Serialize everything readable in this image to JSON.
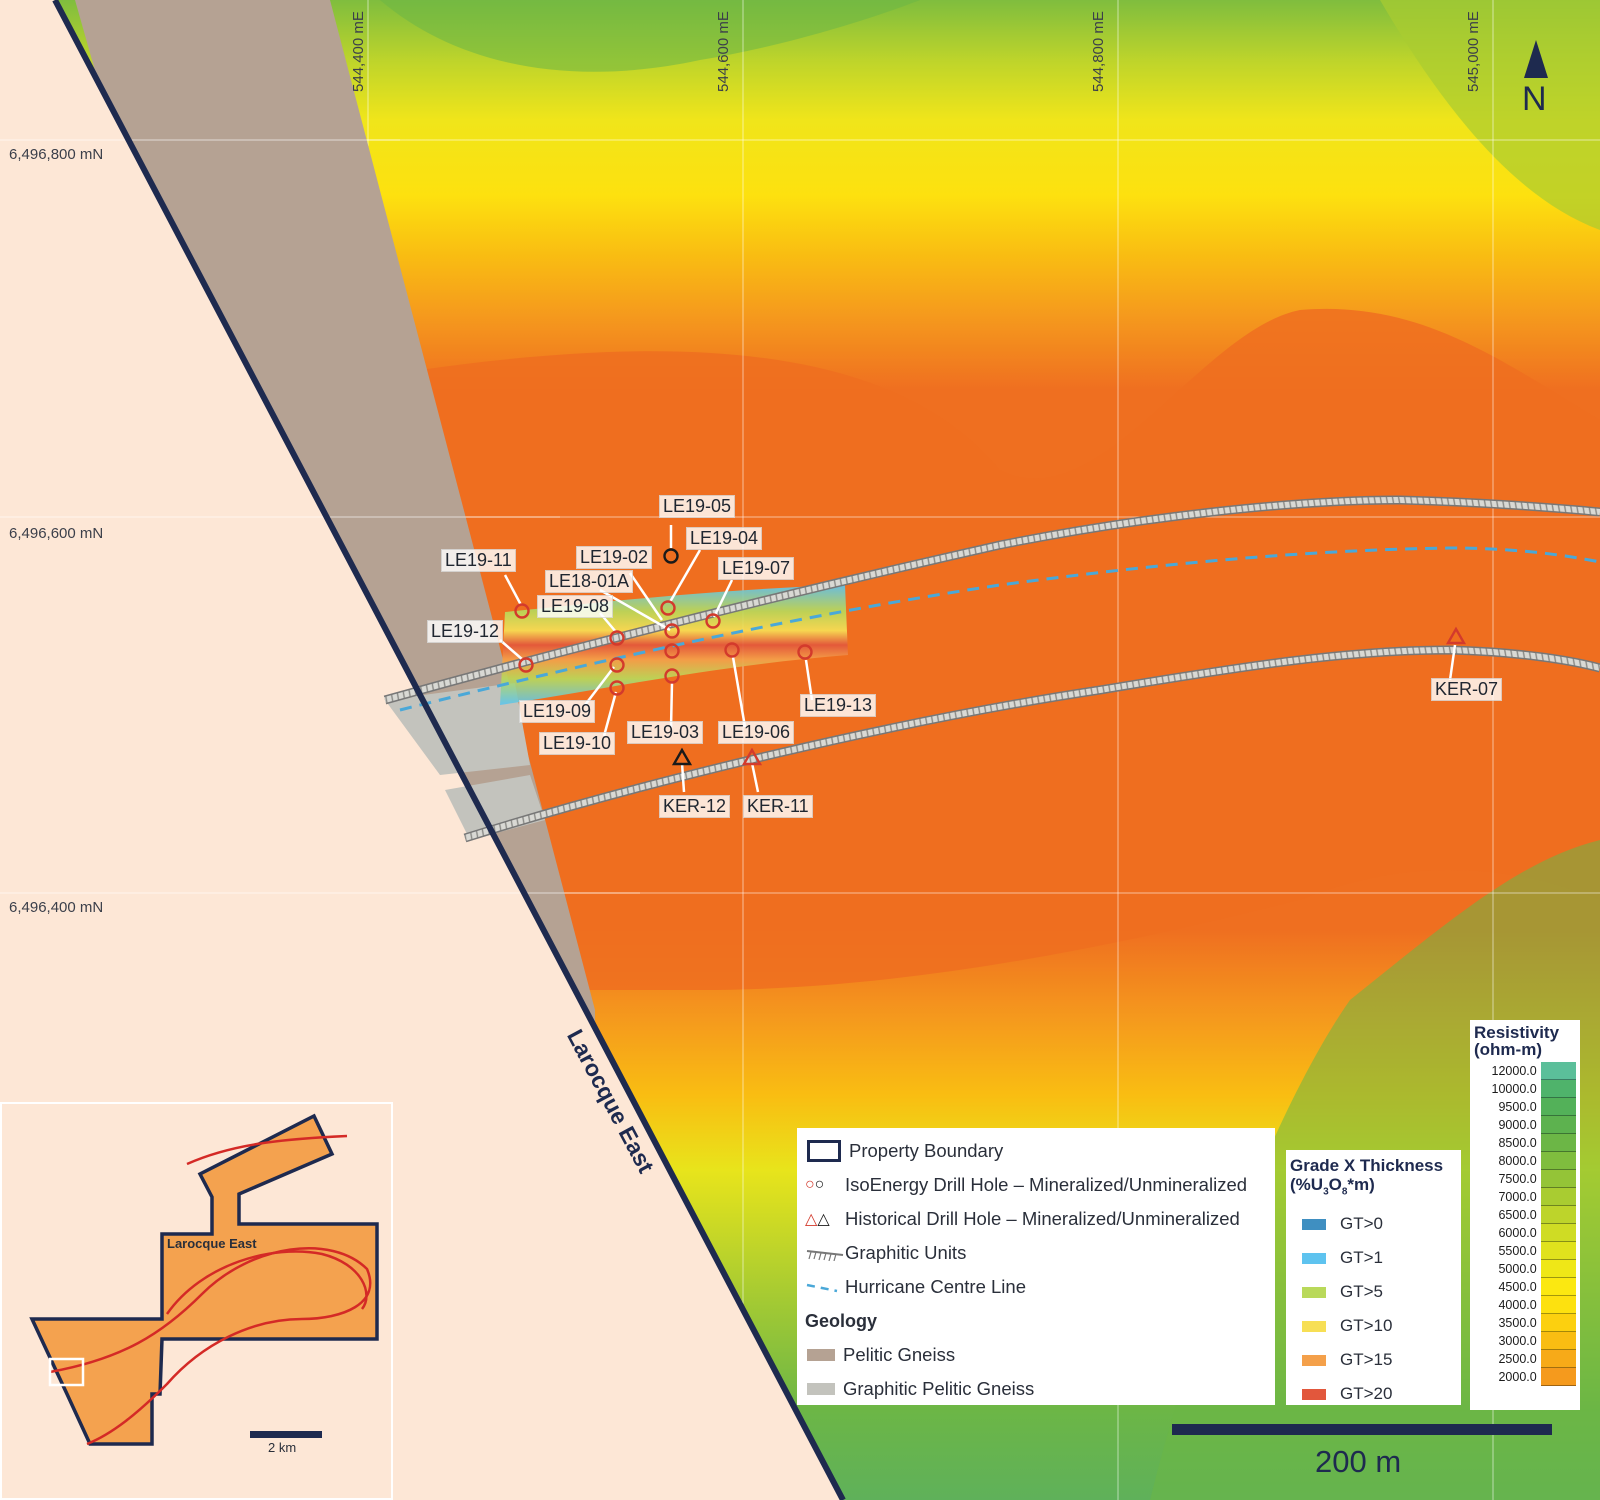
{
  "grid": {
    "eastings": [
      "544,400 mE",
      "544,600 mE",
      "544,800 mE",
      "545,000 mE"
    ],
    "northings": [
      "6,496,800 mN",
      "6,496,600 mN",
      "6,496,400 mN"
    ]
  },
  "north_arrow": "N",
  "property_label": "Larocque East",
  "drill_holes": [
    {
      "id": "LE19-05",
      "status": "unmineralized",
      "type": "isoenergy"
    },
    {
      "id": "LE19-04",
      "status": "mineralized",
      "type": "isoenergy"
    },
    {
      "id": "LE19-02",
      "status": "mineralized",
      "type": "isoenergy"
    },
    {
      "id": "LE19-07",
      "status": "mineralized",
      "type": "isoenergy"
    },
    {
      "id": "LE18-01A",
      "status": "mineralized",
      "type": "isoenergy"
    },
    {
      "id": "LE19-11",
      "status": "mineralized",
      "type": "isoenergy"
    },
    {
      "id": "LE19-08",
      "status": "mineralized",
      "type": "isoenergy"
    },
    {
      "id": "LE19-12",
      "status": "mineralized",
      "type": "isoenergy"
    },
    {
      "id": "LE19-13",
      "status": "mineralized",
      "type": "isoenergy"
    },
    {
      "id": "LE19-09",
      "status": "mineralized",
      "type": "isoenergy"
    },
    {
      "id": "LE19-03",
      "status": "mineralized",
      "type": "isoenergy"
    },
    {
      "id": "LE19-06",
      "status": "mineralized",
      "type": "isoenergy"
    },
    {
      "id": "LE19-10",
      "status": "mineralized",
      "type": "isoenergy"
    },
    {
      "id": "KER-12",
      "status": "unmineralized",
      "type": "historical"
    },
    {
      "id": "KER-11",
      "status": "mineralized",
      "type": "historical"
    },
    {
      "id": "KER-07",
      "status": "mineralized",
      "type": "historical"
    }
  ],
  "legend": {
    "property_boundary": "Property Boundary",
    "isoenergy_hole": "IsoEnergy Drill Hole – Mineralized/Unmineralized",
    "historical_hole": "Historical Drill Hole – Mineralized/Unmineralized",
    "graphitic_units": "Graphitic Units",
    "hurricane_line": "Hurricane Centre Line",
    "geology_title": "Geology",
    "pelitic_gneiss": "Pelitic Gneiss",
    "graphitic_pelitic_gneiss": "Graphitic Pelitic Gneiss",
    "colors": {
      "pelitic": "#b5a293",
      "graphitic_pelitic": "#c3c3bd",
      "boundary": "#1e2a4f",
      "mineralized": "#d33a2c",
      "unmineralized": "#1a1a1a",
      "centre_line": "#4aa8d8"
    }
  },
  "gt_legend": {
    "title_line1": "Grade X Thickness",
    "title_line2_prefix": "(%U",
    "title_sub1": "3",
    "title_mid": "O",
    "title_sub2": "8",
    "title_suffix": "*m)",
    "items": [
      {
        "label": "GT>0",
        "color": "#3f8fc1"
      },
      {
        "label": "GT>1",
        "color": "#5ec3ef"
      },
      {
        "label": "GT>5",
        "color": "#b9d95a"
      },
      {
        "label": "GT>10",
        "color": "#f7df55"
      },
      {
        "label": "GT>15",
        "color": "#f4a04a"
      },
      {
        "label": "GT>20",
        "color": "#e2573c"
      }
    ]
  },
  "resistivity": {
    "title_line1": "Resistivity",
    "title_line2": "(ohm-m)",
    "items": [
      {
        "value": "12000.0",
        "color": "#5bbf9a"
      },
      {
        "value": "10000.0",
        "color": "#4fb36b"
      },
      {
        "value": "9500.0",
        "color": "#53b159"
      },
      {
        "value": "9000.0",
        "color": "#5db24f"
      },
      {
        "value": "8500.0",
        "color": "#6cb646"
      },
      {
        "value": "8000.0",
        "color": "#7fbd3e"
      },
      {
        "value": "7500.0",
        "color": "#94c437"
      },
      {
        "value": "7000.0",
        "color": "#a9cc31"
      },
      {
        "value": "6500.0",
        "color": "#bdd42b"
      },
      {
        "value": "6000.0",
        "color": "#cfdc24"
      },
      {
        "value": "5500.0",
        "color": "#e0e21d"
      },
      {
        "value": "5000.0",
        "color": "#efe717"
      },
      {
        "value": "4500.0",
        "color": "#fbe811"
      },
      {
        "value": "4000.0",
        "color": "#fde10f"
      },
      {
        "value": "3500.0",
        "color": "#fcd00f"
      },
      {
        "value": "3000.0",
        "color": "#f9bd12"
      },
      {
        "value": "2500.0",
        "color": "#f7aa18"
      },
      {
        "value": "2000.0",
        "color": "#f59a1d"
      }
    ]
  },
  "scale_bar": "200 m",
  "inset": {
    "label": "Larocque East",
    "scale": "2 km"
  }
}
